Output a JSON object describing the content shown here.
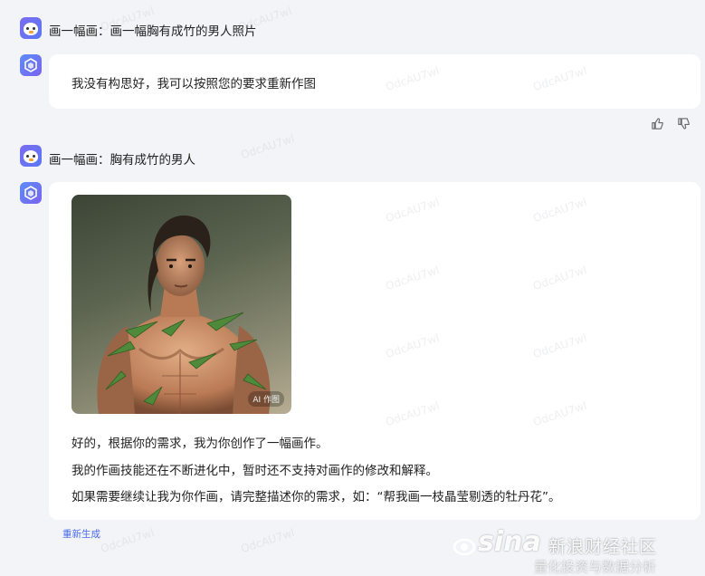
{
  "conversation": [
    {
      "prompt": "画一幅画：画一幅胸有成竹的男人照片",
      "reply": "我没有构思好，我可以按照您的要求重新作图"
    },
    {
      "prompt": "画一幅画：胸有成竹的男人",
      "image_tag": "AI 作图",
      "reply_lines": [
        "好的，根据你的需求，我为你创作了一幅画作。",
        "我的作画技能还在不断进化中，暂时还不支持对画作的修改和解释。",
        "如果需要继续让我为你作画，请完整描述你的需求，如：“帮我画一枝晶莹剔透的牡丹花”。"
      ],
      "regenerate_label": "重新生成"
    }
  ],
  "watermark_text": "OdcAU7wl",
  "overlay_watermark": {
    "brand": "sina",
    "name": "新浪财经社区",
    "sub": "量化投资与数据分析"
  },
  "colors": {
    "background": "#f3f4f8",
    "bubble": "#ffffff",
    "link": "#4b6bea"
  }
}
